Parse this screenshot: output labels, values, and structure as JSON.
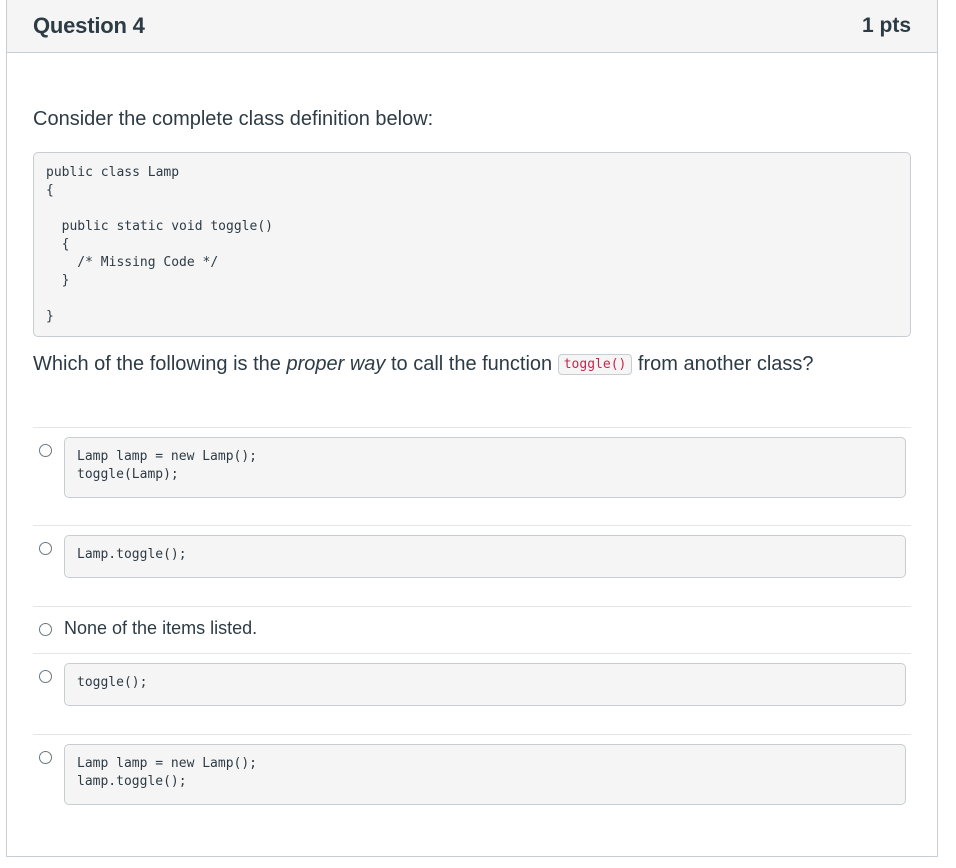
{
  "question": {
    "title": "Question 4",
    "points": "1 pts",
    "intro": "Consider the complete class definition below:",
    "code": "public class Lamp\n{\n\n  public static void toggle()\n  {\n    /* Missing Code */\n  }\n\n}",
    "prompt_before": "Which of the following is the ",
    "prompt_emphasis": "proper way",
    "prompt_middle": " to call the function ",
    "prompt_code": "toggle()",
    "prompt_after": " from another class?"
  },
  "answers": [
    {
      "type": "code",
      "text": "Lamp lamp = new Lamp();\ntoggle(Lamp);"
    },
    {
      "type": "code",
      "text": "Lamp.toggle();"
    },
    {
      "type": "text",
      "text": "None of the items listed."
    },
    {
      "type": "code",
      "text": "toggle();"
    },
    {
      "type": "code",
      "text": "Lamp lamp = new Lamp();\nlamp.toggle();"
    }
  ]
}
